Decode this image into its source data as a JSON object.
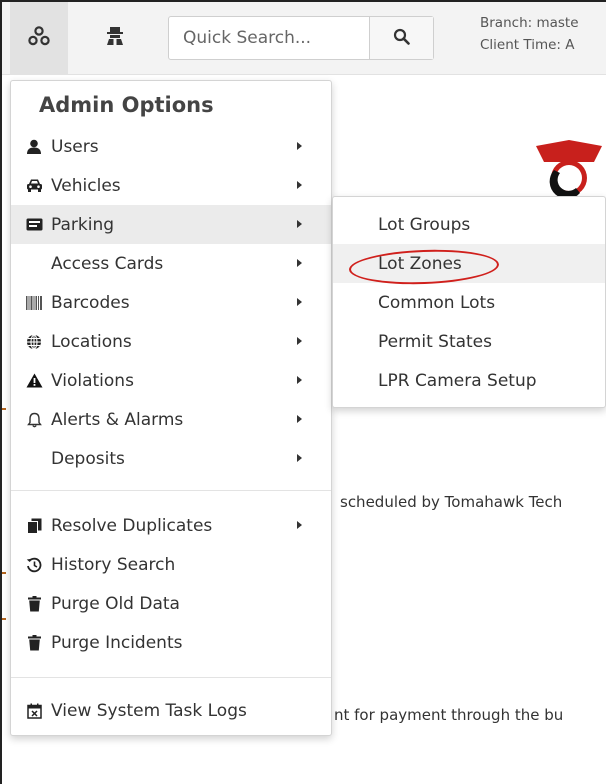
{
  "navbar": {
    "admin_icon": "sitemap-icon",
    "second_icon": "user-secret-icon",
    "search": {
      "placeholder": "Quick Search...",
      "value": ""
    },
    "search_icon": "magnifier-icon",
    "branch_line": "Branch: maste",
    "client_time_line": "Client Time: A"
  },
  "background": {
    "line1": "scheduled by Tomahawk Tech",
    "line2": "nt for payment through the bu"
  },
  "admin_menu": {
    "header": "Admin Options",
    "items": [
      {
        "label": "Users",
        "icon": "user-icon",
        "has_submenu": true
      },
      {
        "label": "Vehicles",
        "icon": "car-icon",
        "has_submenu": true
      },
      {
        "label": "Parking",
        "icon": "parking-sign-icon",
        "has_submenu": true,
        "highlighted": true
      },
      {
        "label": "Access Cards",
        "icon": "",
        "has_submenu": true
      },
      {
        "label": "Barcodes",
        "icon": "barcode-icon",
        "has_submenu": true
      },
      {
        "label": "Locations",
        "icon": "globe-icon",
        "has_submenu": true
      },
      {
        "label": "Violations",
        "icon": "warning-icon",
        "has_submenu": true
      },
      {
        "label": "Alerts & Alarms",
        "icon": "bell-icon",
        "has_submenu": true
      },
      {
        "label": "Deposits",
        "icon": "",
        "has_submenu": true
      },
      {
        "label": "Resolve Duplicates",
        "icon": "copy-icon",
        "has_submenu": true
      },
      {
        "label": "History Search",
        "icon": "history-icon",
        "has_submenu": false
      },
      {
        "label": "Purge Old Data",
        "icon": "trash-icon",
        "has_submenu": false
      },
      {
        "label": "Purge Incidents",
        "icon": "trash-icon",
        "has_submenu": false
      },
      {
        "label": "View System Task Logs",
        "icon": "calendar-x-icon",
        "has_submenu": false
      }
    ]
  },
  "parking_submenu": {
    "items": [
      {
        "label": "Lot Groups"
      },
      {
        "label": "Lot Zones",
        "circled": true
      },
      {
        "label": "Common Lots"
      },
      {
        "label": "Permit States"
      },
      {
        "label": "LPR Camera Setup"
      }
    ]
  },
  "colors": {
    "annotation_ring": "#d0201c",
    "highlight": "#ebebeb",
    "navbar_bg": "#f3f3f3"
  }
}
